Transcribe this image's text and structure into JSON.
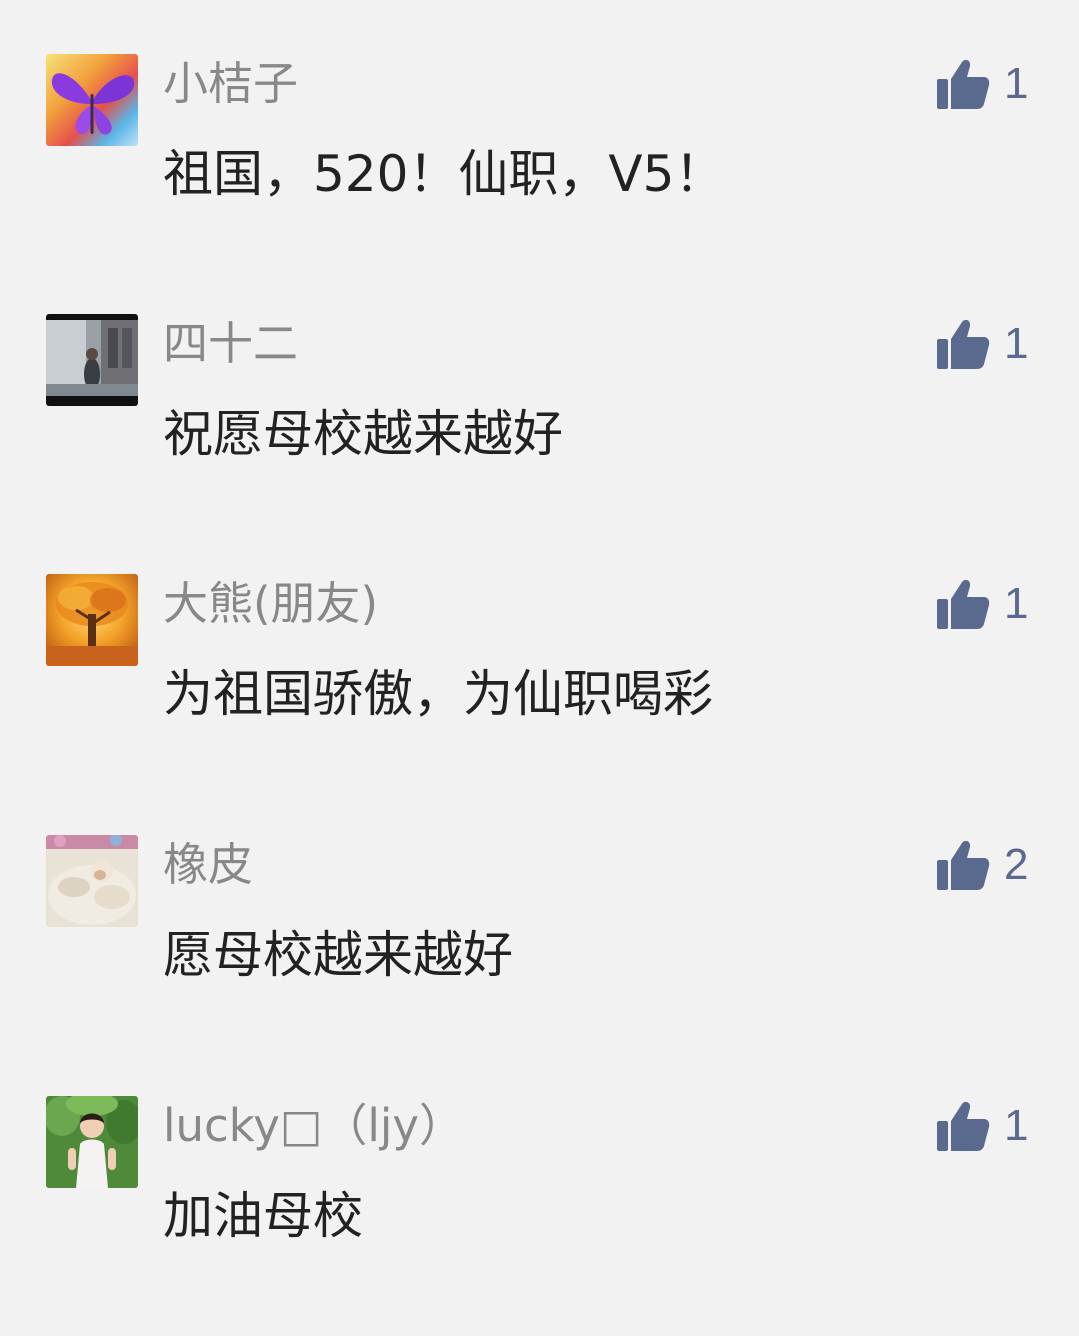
{
  "accent_color": "#5a6a8f",
  "comments": [
    {
      "name": "小桔子",
      "text": "祖国，520！仙职，V5！",
      "likes": "1",
      "avatar_icon": "butterfly-avatar"
    },
    {
      "name": "四十二",
      "text": "祝愿母校越来越好",
      "likes": "1",
      "avatar_icon": "street-photo-avatar"
    },
    {
      "name": "大熊(朋友)",
      "text": "为祖国骄傲，为仙职喝彩",
      "likes": "1",
      "avatar_icon": "autumn-tree-avatar"
    },
    {
      "name": "橡皮",
      "text": "愿母校越来越好",
      "likes": "2",
      "avatar_icon": "baby-photo-avatar"
    },
    {
      "name": "lucky□（ljy）",
      "text": "加油母校",
      "likes": "1",
      "avatar_icon": "girl-photo-avatar"
    }
  ]
}
